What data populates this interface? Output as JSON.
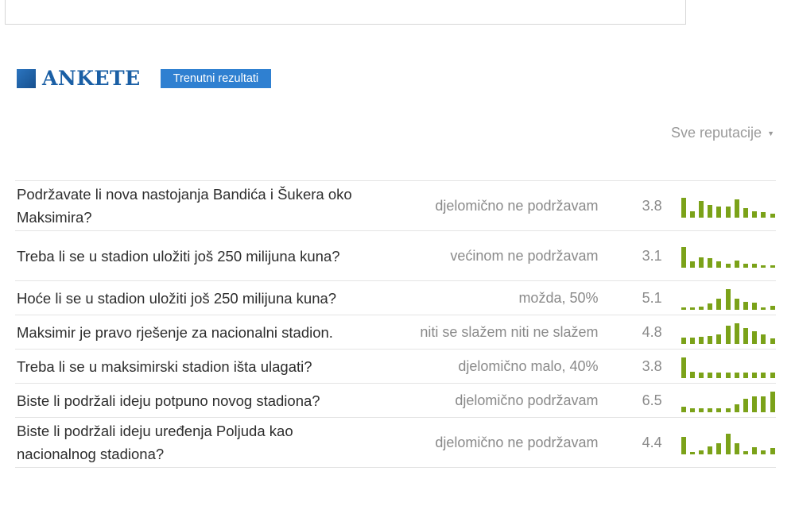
{
  "section": {
    "title": "ANKETE",
    "badge": "Trenutni rezultati",
    "filter_label": "Sve reputacije"
  },
  "colors": {
    "accent_blue": "#1a5fa5",
    "badge_blue": "#2f80d1",
    "sparkline_green": "#7ba219"
  },
  "icons": {
    "header_square": "blue-square-icon",
    "filter_caret": "caret-down-icon"
  },
  "polls": [
    {
      "question": "Podržavate li nova nastojanja Bandića i Šukera oko Maksimira?",
      "answer": "djelomično ne podržavam",
      "score": "3.8",
      "distribution": [
        0.95,
        0.3,
        0.8,
        0.6,
        0.55,
        0.55,
        0.9,
        0.45,
        0.3,
        0.25,
        0.2
      ]
    },
    {
      "question": "Treba li se u stadion uložiti još 250 milijuna kuna?",
      "answer": "većinom ne podržavam",
      "score": "3.1",
      "distribution": [
        1.0,
        0.3,
        0.5,
        0.45,
        0.3,
        0.2,
        0.35,
        0.2,
        0.2,
        0.1,
        0.1
      ]
    },
    {
      "question": "Hoće li se u stadion uložiti još 250 milijuna kuna?",
      "answer": "možda, 50%",
      "score": "5.1",
      "distribution": [
        0.1,
        0.1,
        0.15,
        0.3,
        0.55,
        1.0,
        0.55,
        0.4,
        0.35,
        0.1,
        0.2
      ]
    },
    {
      "question": "Maksimir je pravo rješenje za nacionalni stadion.",
      "answer": "niti se slažem niti ne slažem",
      "score": "4.8",
      "distribution": [
        0.3,
        0.3,
        0.35,
        0.4,
        0.45,
        0.9,
        1.0,
        0.75,
        0.6,
        0.45,
        0.25
      ]
    },
    {
      "question": "Treba li se u maksimirski stadion išta ulagati?",
      "answer": "djelomično malo, 40%",
      "score": "3.8",
      "distribution": [
        1.0,
        0.3,
        0.25,
        0.25,
        0.25,
        0.25,
        0.25,
        0.25,
        0.25,
        0.25,
        0.25
      ]
    },
    {
      "question": "Biste li podržali ideju potpuno novog stadiona?",
      "answer": "djelomično podržavam",
      "score": "6.5",
      "distribution": [
        0.25,
        0.2,
        0.2,
        0.2,
        0.2,
        0.2,
        0.4,
        0.65,
        0.75,
        0.75,
        1.0
      ]
    },
    {
      "question": "Biste li podržali ideju uređenja Poljuda kao nacionalnog stadiona?",
      "answer": "djelomično ne podržavam",
      "score": "4.4",
      "distribution": [
        0.85,
        0.1,
        0.2,
        0.4,
        0.55,
        1.0,
        0.55,
        0.15,
        0.35,
        0.2,
        0.3
      ]
    }
  ]
}
